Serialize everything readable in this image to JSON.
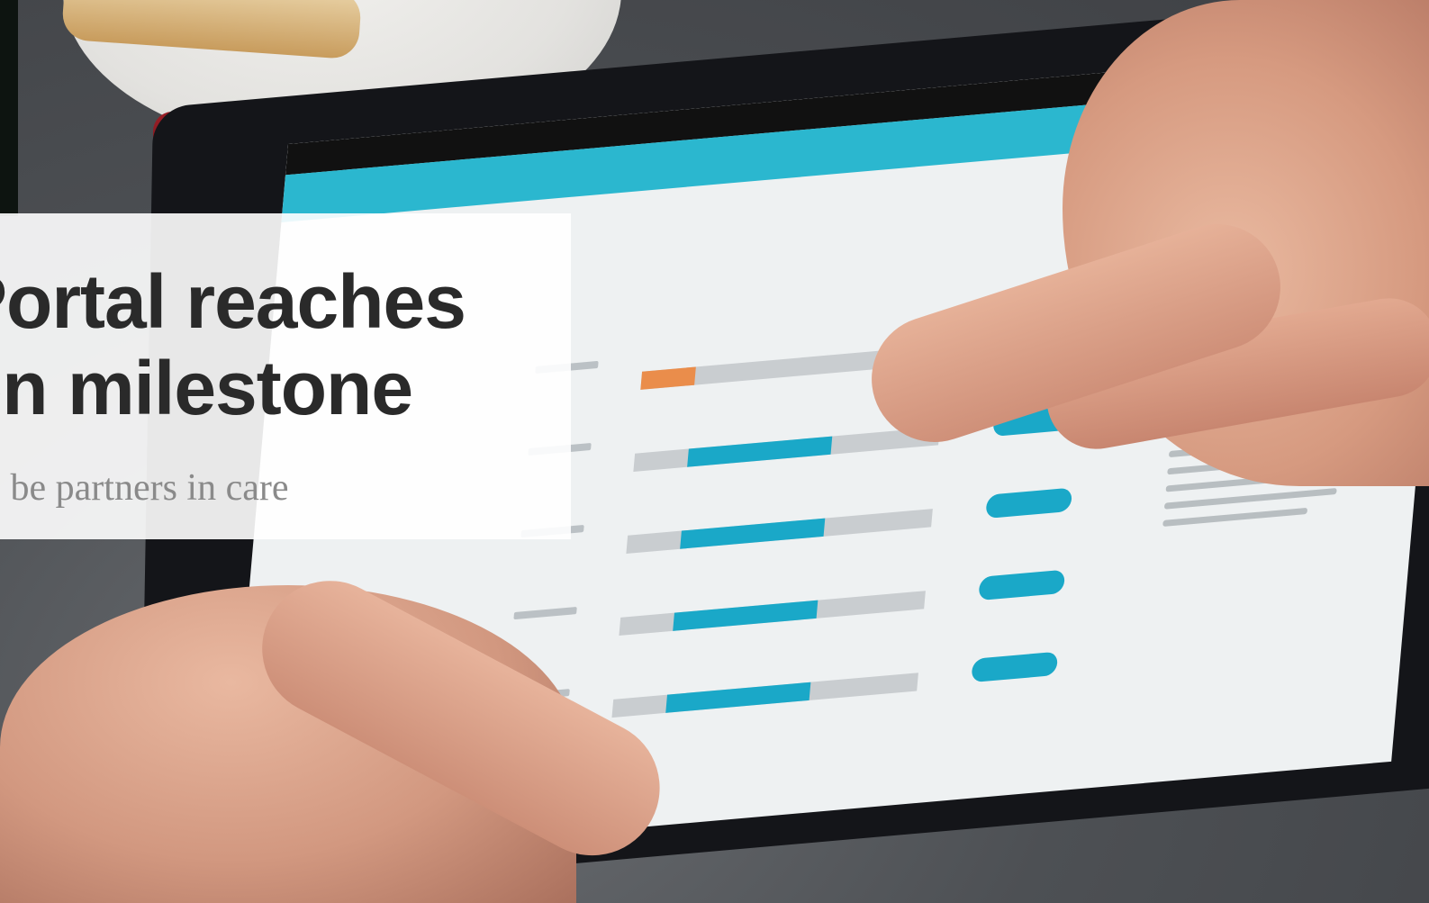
{
  "headline": {
    "title_line_1": "Portal reaches",
    "title_line_2": "on milestone",
    "subtitle": "o be partners in care"
  },
  "colors": {
    "card_background": "#ffffff",
    "title_text": "#2a2a2a",
    "subtitle_text": "#8a8a8a",
    "app_accent": "#1aa8c8",
    "range_out_of_bounds": "#ea8d4b",
    "tablet_case": "#9a1e26"
  },
  "photo": {
    "subject": "hands-using-tablet"
  }
}
